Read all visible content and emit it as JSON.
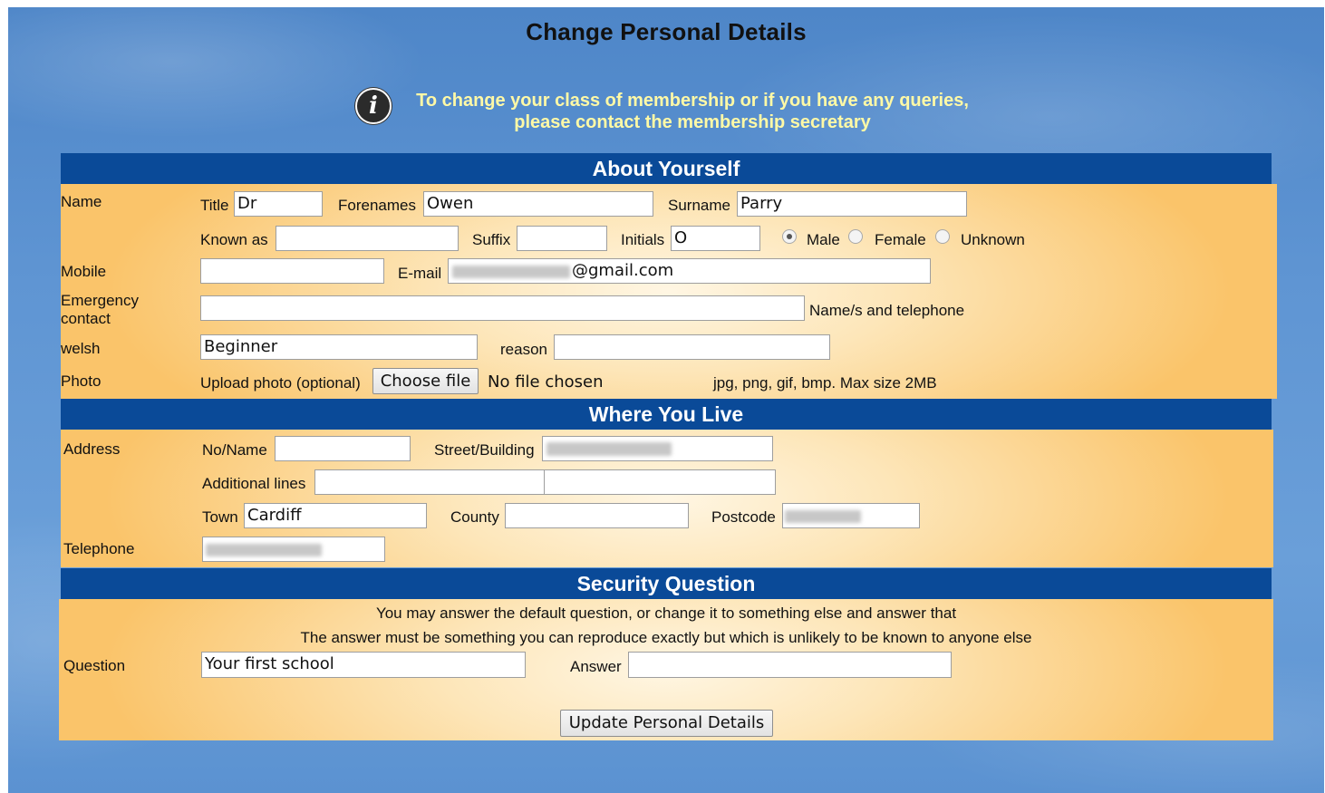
{
  "page": {
    "title": "Change Personal Details",
    "info_line1": "To change your class of membership or if you have any queries,",
    "info_line2": "please contact the membership secretary",
    "info_icon": "i"
  },
  "about": {
    "heading": "About Yourself",
    "name_label": "Name",
    "title_label": "Title",
    "title_value": "Dr",
    "forenames_label": "Forenames",
    "forenames_value": "Owen",
    "surname_label": "Surname",
    "surname_value": "Parry",
    "known_as_label": "Known as",
    "known_as_value": "",
    "suffix_label": "Suffix",
    "suffix_value": "",
    "initials_label": "Initials",
    "initials_value": "O",
    "gender_options": [
      "Male",
      "Female",
      "Unknown"
    ],
    "gender_selected": "Male",
    "mobile_label": "Mobile",
    "mobile_value": "",
    "email_label": "E-mail",
    "email_visible_suffix": "@gmail.com",
    "emergency_label_line1": "Emergency",
    "emergency_label_line2": "contact",
    "emergency_value": "",
    "emergency_hint": "Name/s and telephone",
    "welsh_label": "welsh",
    "welsh_value": "Beginner",
    "reason_label": "reason",
    "reason_value": "",
    "photo_label": "Photo",
    "upload_label": "Upload photo (optional)",
    "choose_file_label": "Choose file",
    "no_file_text": "No file chosen",
    "photo_hint": "jpg, png, gif, bmp. Max size 2MB"
  },
  "where": {
    "heading": "Where You Live",
    "address_label": "Address",
    "no_name_label": "No/Name",
    "no_name_value": "",
    "street_label": "Street/Building",
    "additional_label": "Additional lines",
    "town_label": "Town",
    "town_value": "Cardiff",
    "county_label": "County",
    "county_value": "",
    "postcode_label": "Postcode",
    "telephone_label": "Telephone"
  },
  "security": {
    "heading": "Security Question",
    "note_line1": "You may answer the default question, or change it to something else and answer that",
    "note_line2": "The answer must be something you can reproduce exactly but which is unlikely to be known to anyone else",
    "question_label": "Question",
    "question_value": "Your first school",
    "answer_label": "Answer",
    "answer_value": "",
    "submit_label": "Update Personal Details"
  },
  "colors": {
    "band": "#0a4a98",
    "info_text": "#fff9a6",
    "panel_edge": "#fac46a",
    "panel_center": "#fff6e3",
    "background": "#5f95d3"
  }
}
